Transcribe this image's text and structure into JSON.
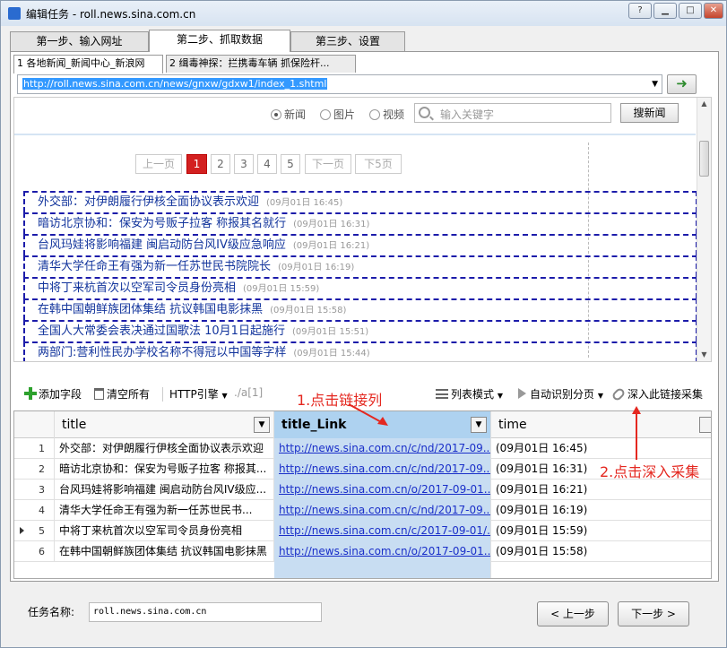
{
  "window": {
    "title": "编辑任务 - roll.news.sina.com.cn",
    "controls": {
      "help": "?",
      "minimize": "▁",
      "maximize": "□",
      "close": "✕"
    }
  },
  "steps": [
    "第一步、输入网址",
    "第二步、抓取数据",
    "第三步、设置"
  ],
  "subtabs": [
    "1 各地新闻_新闻中心_新浪网",
    "2 缉毒神探：拦携毒车辆 抓保险杆..."
  ],
  "url": {
    "value": "http://roll.news.sina.com.cn/news/gnxw/gdxw1/index_1.shtml",
    "go": "➜"
  },
  "search": {
    "options": [
      "新闻",
      "图片",
      "视频"
    ],
    "selected": "新闻",
    "placeholder": "输入关键字",
    "button": "搜新闻"
  },
  "pager": {
    "prev": "上一页",
    "pages": [
      "1",
      "2",
      "3",
      "4",
      "5"
    ],
    "current": "1",
    "next": "下一页",
    "next5": "下5页"
  },
  "news": [
    {
      "title": "外交部：对伊朗履行伊核全面协议表示欢迎",
      "time": "(09月01日 16:45)"
    },
    {
      "title": "暗访北京协和：保安为号贩子拉客 称报其名就行",
      "time": "(09月01日 16:31)"
    },
    {
      "title": "台风玛娃将影响福建 闽启动防台风IV级应急响应",
      "time": "(09月01日 16:21)"
    },
    {
      "title": "清华大学任命王有强为新一任苏世民书院院长",
      "time": "(09月01日 16:19)"
    },
    {
      "title": "中将丁来杭首次以空军司令员身份亮相",
      "time": "(09月01日 15:59)"
    },
    {
      "title": "在韩中国朝鲜族团体集结 抗议韩国电影抹黑",
      "time": "(09月01日 15:58)"
    },
    {
      "title": "全国人大常委会表决通过国歌法 10月1日起施行",
      "time": "(09月01日 15:51)"
    },
    {
      "title": "两部门:营利性民办学校名称不得冠以中国等字样",
      "time": "(09月01日 15:44)"
    }
  ],
  "toolbar": {
    "add_field": "添加字段",
    "clear_all": "清空所有",
    "http_engine": "HTTP引擎",
    "xpath": "./a[1]",
    "list_mode": "列表模式",
    "auto_page": "自动识别分页",
    "deep_collect": "深入此链接采集"
  },
  "grid": {
    "columns": [
      "title",
      "title_Link",
      "time"
    ],
    "rows": [
      {
        "n": "1",
        "title": "外交部：对伊朗履行伊核全面协议表示欢迎",
        "link": "http://news.sina.com.cn/c/nd/2017-09...",
        "time": "(09月01日 16:45)"
      },
      {
        "n": "2",
        "title": "暗访北京协和：保安为号贩子拉客 称报其...",
        "link": "http://news.sina.com.cn/c/nd/2017-09...",
        "time": "(09月01日 16:31)"
      },
      {
        "n": "3",
        "title": "台风玛娃将影响福建 闽启动防台风IV级应...",
        "link": "http://news.sina.com.cn/o/2017-09-01...",
        "time": "(09月01日 16:21)"
      },
      {
        "n": "4",
        "title": "清华大学任命王有强为新一任苏世民书...",
        "link": "http://news.sina.com.cn/c/nd/2017-09...",
        "time": "(09月01日 16:19)"
      },
      {
        "n": "5",
        "title": "中将丁来杭首次以空军司令员身份亮相",
        "link": "http://news.sina.com.cn/c/2017-09-01/...",
        "time": "(09月01日 15:59)"
      },
      {
        "n": "6",
        "title": "在韩中国朝鲜族团体集结 抗议韩国电影抹黑",
        "link": "http://news.sina.com.cn/o/2017-09-01...",
        "time": "(09月01日 15:58)"
      }
    ]
  },
  "annotations": {
    "click_link_col": "1.点击链接列",
    "click_deep": "2.点击深入采集"
  },
  "footer": {
    "task_label": "任务名称:",
    "task_name": "roll.news.sina.com.cn",
    "prev": "< 上一步",
    "next": "下一步 >"
  },
  "colors": {
    "annotation": "#e42820",
    "selected_column": "#aed2f0",
    "link": "#1a2fc9",
    "page_current": "#d32020"
  }
}
